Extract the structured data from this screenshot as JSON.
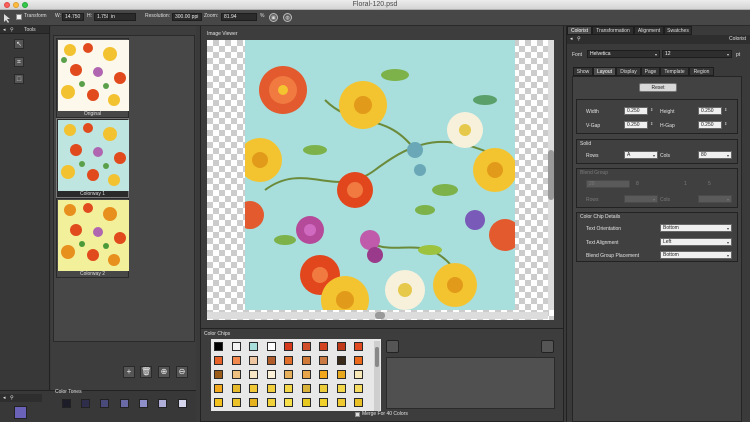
{
  "window": {
    "title": "Floral-120.psd"
  },
  "optionsbar": {
    "transform_label": "Transform",
    "w_label": "W:",
    "w_value": "14.750",
    "h_label": "H:",
    "h_value": "1.750",
    "unit_value": "in",
    "resolution_label": "Resolution:",
    "resolution_value": "300.00 ppi",
    "zoom_label": "Zoom:",
    "zoom_value": "81.94",
    "zoom_unit": "%"
  },
  "tools_panel": {
    "title": "Tools"
  },
  "colorways": [
    {
      "label": "Original",
      "bg": "#fdf8ec"
    },
    {
      "label": "Colorway 1",
      "bg": "#bfe5e0"
    },
    {
      "label": "Colorway 2",
      "bg": "#f2f09a"
    }
  ],
  "color_tones": {
    "title": "Color Tones",
    "swatches": [
      "#1d1d2a",
      "#2e2e4a",
      "#4a4a7a",
      "#6a6aa6",
      "#8e8ec8",
      "#aeaed8",
      "#d6d6ec"
    ],
    "current_color": "#6a62b8"
  },
  "image_viewer": {
    "title": "Image Viewer"
  },
  "color_chips": {
    "title": "Color Chips",
    "rows": [
      [
        "#000000",
        "#f2f2f2",
        "#a8dedb",
        "#ffffff",
        "#d63a1d",
        "#d04f2a",
        "#d24520",
        "#c03a1a",
        "#e24a22"
      ],
      [
        "#e8632a",
        "#f1884d",
        "#efc6a2",
        "#b05c2a",
        "#e2702c",
        "#d07a3a",
        "#c87a42",
        "#3a2a1a",
        "#ed6a1c"
      ],
      [
        "#9b5c1a",
        "#f0c080",
        "#f6e6c6",
        "#fbefd8",
        "#e6b05a",
        "#e9a54a",
        "#f2a71a",
        "#e8a81e",
        "#f8e8b8"
      ],
      [
        "#f2a91e",
        "#e6ba2a",
        "#f0c838",
        "#f1cf3e",
        "#f5d84a",
        "#d9b23a",
        "#eccc3a",
        "#f4d84c",
        "#f6dd62"
      ],
      [
        "#f3c21f",
        "#ebc228",
        "#e6b21e",
        "#f2d23a",
        "#f8e04a",
        "#e6c81e",
        "#f0d02a",
        "#eec930",
        "#e9c124"
      ]
    ],
    "footer_label": "Merge For 40 Colors"
  },
  "colorist": {
    "tabs": [
      "Colorist",
      "Transformation",
      "Alignment",
      "Swatches"
    ],
    "panel_title": "Colorist",
    "font_label": "Font",
    "font_value": "Helvetica",
    "size_value": "12",
    "size_unit": "pt",
    "subtabs": [
      "Show",
      "Layout",
      "Display",
      "Page",
      "Template",
      "Region"
    ],
    "reset_label": "Reset",
    "width_label": "Width",
    "width_value": "0.250",
    "height_label": "Height",
    "height_value": "0.250",
    "vgap_label": "V-Gap",
    "vgap_value": "0.250",
    "hgap_label": "H-Gap",
    "hgap_value": "0.250",
    "solid_title": "Solid",
    "rows_label": "Rows",
    "rows_value": "A",
    "cols_label": "Cols",
    "cols_value": "80",
    "blend_title": "Blend Group",
    "blend_value": "20",
    "blend_x": "8",
    "blend_n1": "1",
    "blend_n2": "5",
    "blend_rows_label": "Rows",
    "blend_cols_label": "Cols",
    "details_title": "Color Chip Details",
    "text_orientation_label": "Text Orientation",
    "text_orientation_value": "Bottom",
    "text_alignment_label": "Text Alignment",
    "text_alignment_value": "Left",
    "blend_placement_label": "Blend Group Placement",
    "blend_placement_value": "Bottom"
  }
}
